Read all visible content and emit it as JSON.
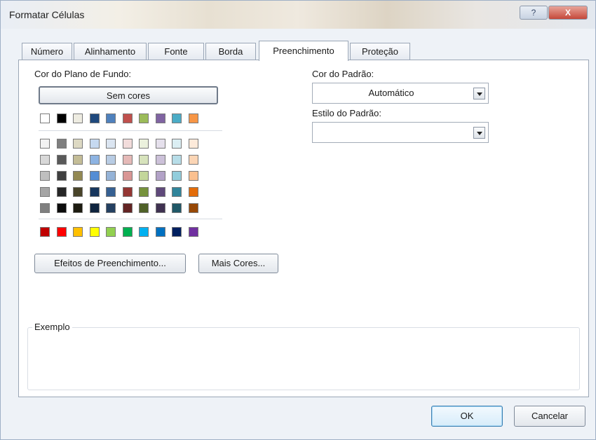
{
  "window": {
    "title": "Formatar Células",
    "help_label": "?",
    "close_label": "X"
  },
  "tabs": [
    {
      "label": "Número"
    },
    {
      "label": "Alinhamento"
    },
    {
      "label": "Fonte"
    },
    {
      "label": "Borda"
    },
    {
      "label": "Preenchimento",
      "active": true
    },
    {
      "label": "Proteção"
    }
  ],
  "fill": {
    "background_label": "Cor do Plano de Fundo:",
    "no_colors_label": "Sem cores",
    "theme_row": [
      "#ffffff",
      "#000000",
      "#eeece1",
      "#1f497d",
      "#4f81bd",
      "#c0504d",
      "#9bbb59",
      "#8064a2",
      "#4bacc6",
      "#f79646"
    ],
    "tint_rows": [
      [
        "#f2f2f2",
        "#7f7f7f",
        "#ddd9c3",
        "#c6d9f0",
        "#dbe5f1",
        "#f2dcdb",
        "#ebf1dd",
        "#e5e0ec",
        "#dbeef3",
        "#fdeada"
      ],
      [
        "#d8d8d8",
        "#595959",
        "#c4bd97",
        "#8db3e2",
        "#b8cce4",
        "#e5b9b7",
        "#d7e3bc",
        "#ccc1d9",
        "#b7dde8",
        "#fbd5b5"
      ],
      [
        "#bfbfbf",
        "#3f3f3f",
        "#938953",
        "#548dd4",
        "#95b3d7",
        "#d99694",
        "#c3d69b",
        "#b2a2c7",
        "#92cddc",
        "#fac08f"
      ],
      [
        "#a5a5a5",
        "#262626",
        "#494429",
        "#17365d",
        "#366092",
        "#953734",
        "#76923c",
        "#5f497a",
        "#31859b",
        "#e36c09"
      ],
      [
        "#7f7f7f",
        "#0c0c0c",
        "#1d1b10",
        "#0f243e",
        "#244061",
        "#632423",
        "#4f6128",
        "#3f3151",
        "#205867",
        "#974806"
      ]
    ],
    "standard_row": [
      "#c00000",
      "#ff0000",
      "#ffc000",
      "#ffff00",
      "#92d050",
      "#00b050",
      "#00b0f0",
      "#0070c0",
      "#002060",
      "#7030a0"
    ],
    "fill_effects_label": "Efeitos de Preenchimento...",
    "more_colors_label": "Mais Cores...",
    "pattern_color_label": "Cor do Padrão:",
    "pattern_color_value": "Automático",
    "pattern_style_label": "Estilo do Padrão:",
    "pattern_style_value": "",
    "sample_label": "Exemplo"
  },
  "buttons": {
    "ok": "OK",
    "cancel": "Cancelar"
  }
}
